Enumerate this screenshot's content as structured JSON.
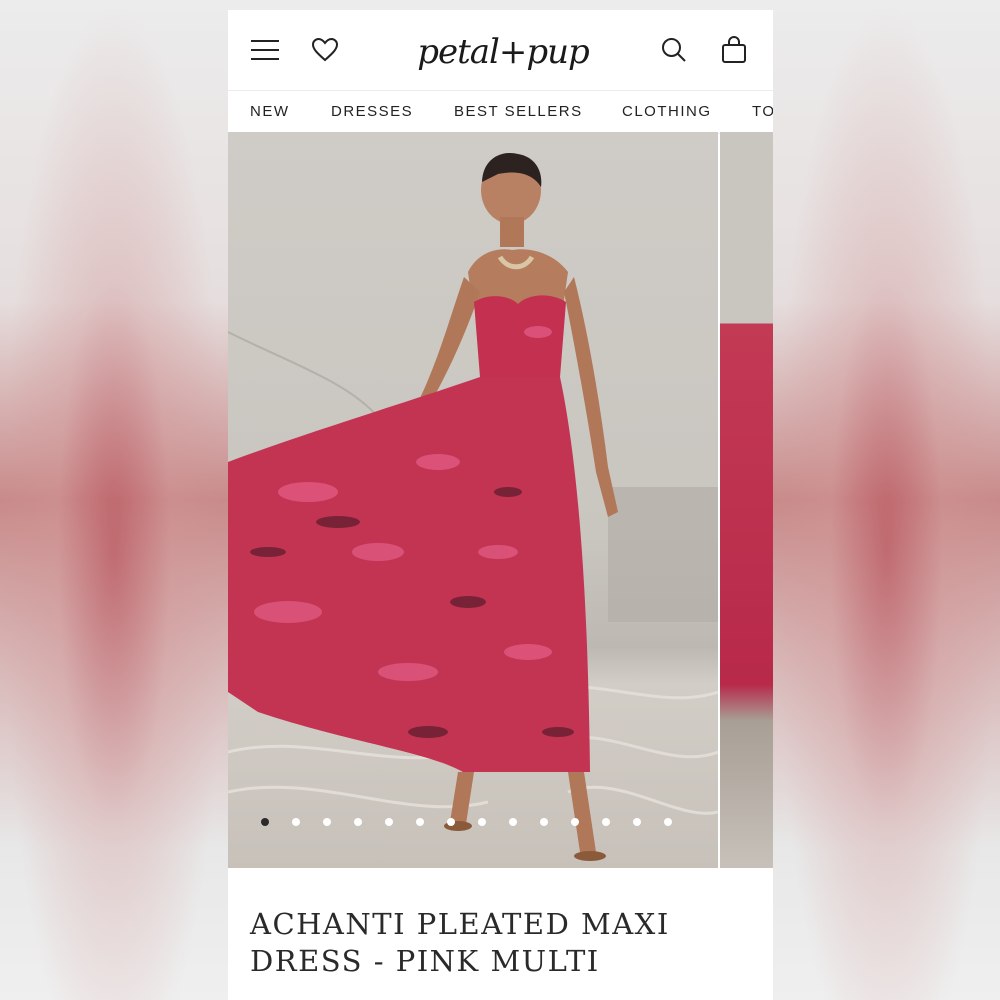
{
  "header": {
    "logo_text": "petal+pup",
    "menu_icon": "hamburger-menu-icon",
    "wishlist_icon": "heart-icon",
    "search_icon": "search-icon",
    "bag_icon": "shopping-bag-icon"
  },
  "nav": {
    "items": [
      {
        "label": "NEW"
      },
      {
        "label": "DRESSES"
      },
      {
        "label": "BEST SELLERS"
      },
      {
        "label": "CLOTHING"
      },
      {
        "label": "TO"
      }
    ]
  },
  "gallery": {
    "image_count": 14,
    "active_index": 0
  },
  "product": {
    "title_line1": "ACHANTI PLEATED MAXI",
    "title_line2": "DRESS - PINK MULTI"
  },
  "colors": {
    "text": "#222222",
    "dress_accent": "#c33a55",
    "active_dot": "#2b2b2b"
  }
}
